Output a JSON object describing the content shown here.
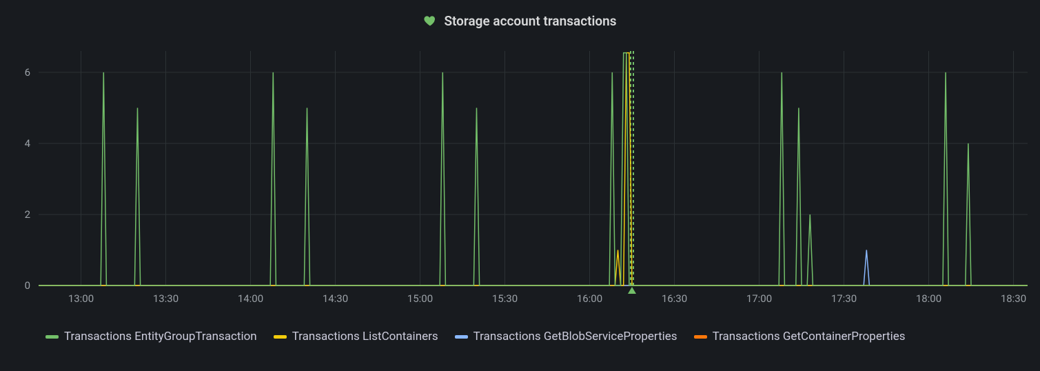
{
  "title": "Storage account transactions",
  "title_icon": "heart-icon",
  "colors": {
    "green": "#73bf69",
    "yellow": "#f2cc0c",
    "blue": "#8ab8ff",
    "orange": "#ff780a",
    "annot_green": "#56a64b"
  },
  "legend": [
    {
      "label": "Transactions EntityGroupTransaction",
      "color": "green"
    },
    {
      "label": "Transactions ListContainers",
      "color": "yellow"
    },
    {
      "label": "Transactions GetBlobServiceProperties",
      "color": "blue"
    },
    {
      "label": "Transactions GetContainerProperties",
      "color": "orange"
    }
  ],
  "chart_data": {
    "type": "line",
    "xlabel": "",
    "ylabel": "",
    "x_type": "time",
    "x_range_minutes": [
      765,
      1115
    ],
    "x_ticks": [
      "13:00",
      "13:30",
      "14:00",
      "14:30",
      "15:00",
      "15:30",
      "16:00",
      "16:30",
      "17:00",
      "17:30",
      "18:00",
      "18:30"
    ],
    "x_tick_minutes": [
      780,
      810,
      840,
      870,
      900,
      930,
      960,
      990,
      1020,
      1050,
      1080,
      1110
    ],
    "y_ticks": [
      0,
      2,
      4,
      6
    ],
    "ylim": [
      0,
      6.6
    ],
    "annotations": [
      {
        "x_minute": 975,
        "color": "green",
        "marker": "triangle"
      }
    ],
    "series": [
      {
        "name": "Transactions EntityGroupTransaction",
        "color": "green",
        "points": [
          [
            765,
            0
          ],
          [
            787,
            0
          ],
          [
            788,
            6
          ],
          [
            789,
            0
          ],
          [
            799,
            0
          ],
          [
            800,
            5
          ],
          [
            801,
            0
          ],
          [
            847,
            0
          ],
          [
            848,
            6
          ],
          [
            849,
            0
          ],
          [
            859,
            0
          ],
          [
            860,
            5
          ],
          [
            861,
            0
          ],
          [
            907,
            0
          ],
          [
            908,
            6
          ],
          [
            909,
            0
          ],
          [
            919,
            0
          ],
          [
            920,
            5
          ],
          [
            921,
            0
          ],
          [
            967,
            0
          ],
          [
            968,
            6
          ],
          [
            969,
            0
          ],
          [
            971,
            0
          ],
          [
            972,
            6.55
          ],
          [
            973,
            6.55
          ],
          [
            974,
            0
          ],
          [
            1027,
            0
          ],
          [
            1028,
            6
          ],
          [
            1029,
            0
          ],
          [
            1033,
            0
          ],
          [
            1034,
            5
          ],
          [
            1035,
            0
          ],
          [
            1037,
            0
          ],
          [
            1038,
            2
          ],
          [
            1039,
            0
          ],
          [
            1085,
            0
          ],
          [
            1086,
            6
          ],
          [
            1087,
            0
          ],
          [
            1093,
            0
          ],
          [
            1094,
            4
          ],
          [
            1095,
            0
          ],
          [
            1115,
            0
          ]
        ]
      },
      {
        "name": "Transactions ListContainers",
        "color": "yellow",
        "points": [
          [
            765,
            0
          ],
          [
            969,
            0
          ],
          [
            970,
            1
          ],
          [
            971,
            0
          ],
          [
            972,
            0
          ],
          [
            973,
            6.55
          ],
          [
            974,
            6.55
          ],
          [
            975,
            0
          ],
          [
            1115,
            0
          ]
        ]
      },
      {
        "name": "Transactions GetBlobServiceProperties",
        "color": "blue",
        "points": [
          [
            765,
            0
          ],
          [
            1057,
            0
          ],
          [
            1058,
            1
          ],
          [
            1059,
            0
          ],
          [
            1115,
            0
          ]
        ]
      },
      {
        "name": "Transactions GetContainerProperties",
        "color": "orange",
        "points": [
          [
            765,
            0
          ],
          [
            1115,
            0
          ]
        ]
      }
    ]
  }
}
